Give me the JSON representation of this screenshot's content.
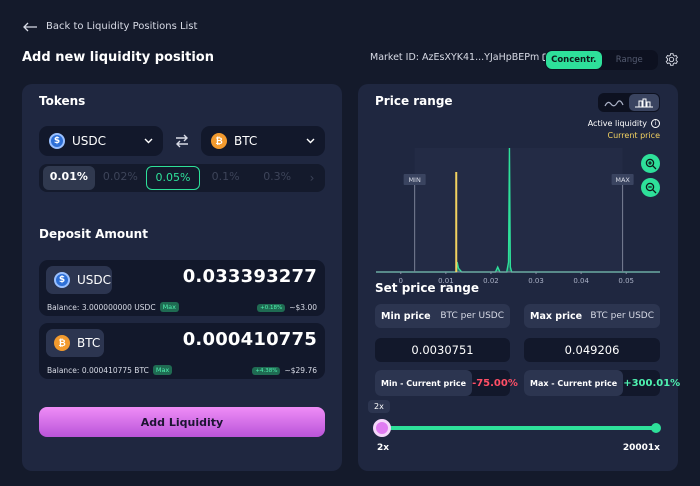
{
  "header": {
    "back_label": "Back to Liquidity Positions List",
    "title": "Add new liquidity position",
    "market_label": "Market ID: AzEsXYK41...YJaHpBEPm",
    "modes": [
      "Concentr.",
      "Range"
    ],
    "active_mode": "Concentr."
  },
  "tokens": {
    "title": "Tokens",
    "token_a": {
      "symbol": "USDC",
      "icon": "usdc-coin-icon"
    },
    "token_b": {
      "symbol": "BTC",
      "icon": "btc-coin-icon"
    },
    "fees": [
      "0.01%",
      "0.02%",
      "0.05%",
      "0.1%",
      "0.3%"
    ],
    "fee_default": "0.01%",
    "fee_selected": "0.05%"
  },
  "deposit": {
    "title": "Deposit Amount",
    "a": {
      "symbol": "USDC",
      "amount": "0.033393277",
      "balance": "Balance: 3.000000000 USDC",
      "max": "Max",
      "change": "+0.18%",
      "usd": "~$3.00"
    },
    "b": {
      "symbol": "BTC",
      "amount": "0.000410775",
      "balance": "Balance: 0.000410775 BTC",
      "max": "Max",
      "change": "+4.38%",
      "usd": "~$29.76"
    }
  },
  "add_button": "Add Liquidity",
  "price_range": {
    "title": "Price range",
    "legend_active": "Active liquidity",
    "legend_current": "Current price",
    "min_marker": "MIN",
    "max_marker": "MAX"
  },
  "chart_data": {
    "type": "area",
    "x_ticks": [
      "0",
      "0.01",
      "0.02",
      "0.03",
      "0.04",
      "0.05"
    ],
    "xlim": [
      -0.0055,
      0.0575
    ],
    "current_price": 0.0123,
    "min_price": 0.0030751,
    "max_price": 0.049206,
    "liquidity_series": [
      [
        -0.0055,
        0.0
      ],
      [
        0.0,
        0.0
      ],
      [
        0.0123,
        0.0
      ],
      [
        0.0125,
        0.08
      ],
      [
        0.0128,
        0.03
      ],
      [
        0.0135,
        0.0
      ],
      [
        0.021,
        0.0
      ],
      [
        0.0215,
        0.04
      ],
      [
        0.022,
        0.0
      ],
      [
        0.0235,
        0.0
      ],
      [
        0.0239,
        0.08
      ],
      [
        0.0241,
        1.0
      ],
      [
        0.0243,
        0.04
      ],
      [
        0.0246,
        0.0
      ],
      [
        0.0575,
        0.0
      ]
    ]
  },
  "set_price_range": {
    "title": "Set price range",
    "min": {
      "label": "Min price",
      "unit": "BTC per USDC",
      "value": "0.0030751",
      "cur_label": "Min - Current price",
      "cur_value": "-75.00%"
    },
    "max": {
      "label": "Max price",
      "unit": "BTC per USDC",
      "value": "0.049206",
      "cur_label": "Max - Current price",
      "cur_value": "+300.01%"
    }
  },
  "slider": {
    "badge": "2x",
    "min_label": "2x",
    "max_label": "20001x",
    "fraction": 0.0
  },
  "colors": {
    "accent_green": "#2ee09a",
    "accent_pink": "#e07cf2",
    "current_price": "#f3d260",
    "negative": "#ff4f66"
  }
}
